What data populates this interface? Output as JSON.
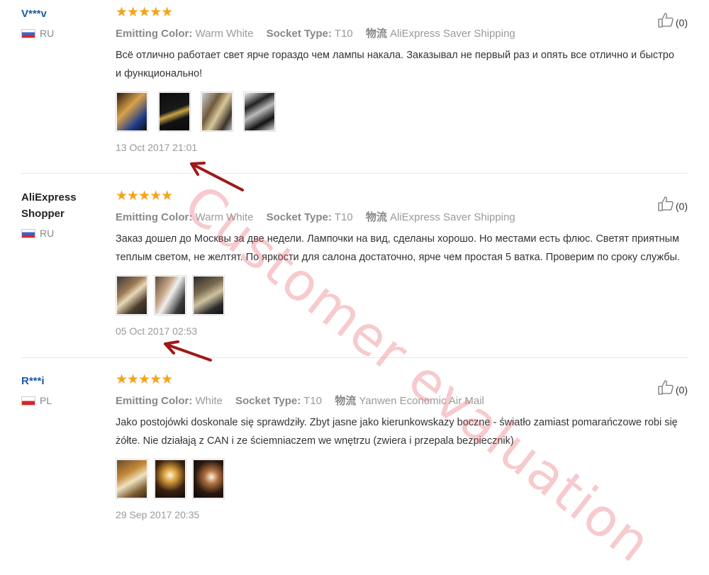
{
  "reviews": [
    {
      "username": "V***v",
      "country": "RU",
      "stars": "★★★★★",
      "color_label": "Emitting Color:",
      "color_value": "Warm White",
      "socket_label": "Socket Type:",
      "socket_value": "T10",
      "ship_label": "物流",
      "ship_value": "AliExpress Saver Shipping",
      "text": "Всё отлично работает свет ярче гораздо чем лампы накала. Заказывал не первый раз и опять все отлично и быстро и функционально!",
      "date": "13 Oct 2017 21:01",
      "likes": "(0)"
    },
    {
      "username": "AliExpress Shopper",
      "country": "RU",
      "stars": "★★★★★",
      "color_label": "Emitting Color:",
      "color_value": "Warm White",
      "socket_label": "Socket Type:",
      "socket_value": "T10",
      "ship_label": "物流",
      "ship_value": "AliExpress Saver Shipping",
      "text": "Заказ дошел до Москвы за две недели. Лампочки на вид, сделаны хорошо. Но местами есть флюс. Светят приятным теплым светом, не желтят. По яркости для салона достаточно, ярче чем простая 5 ватка. Проверим по сроку службы.",
      "date": "05 Oct 2017 02:53",
      "likes": "(0)"
    },
    {
      "username": "R***i",
      "country": "PL",
      "stars": "★★★★★",
      "color_label": "Emitting Color:",
      "color_value": "White",
      "socket_label": "Socket Type:",
      "socket_value": "T10",
      "ship_label": "物流",
      "ship_value": "Yanwen Economic Air Mail",
      "text": "Jako postojówki doskonale się sprawdziły. Zbyt jasne jako kierunkowskazy boczne - światło zamiast pomarańczowe robi się żółte. Nie działają z CAN i ze ściemniaczem we wnętrzu (zwiera i przepala bezpiecznik)",
      "date": "29 Sep 2017 20:35",
      "likes": "(0)"
    }
  ],
  "watermark": "Customer evaluation",
  "colors": {
    "link": "#1a5aa8",
    "star": "#f5a31a",
    "watermark": "#e65a64",
    "arrow": "#a01818"
  },
  "icons": {
    "like": "thumbs-up-icon",
    "flag": "flag-icon",
    "arrow": "arrow-icon"
  }
}
